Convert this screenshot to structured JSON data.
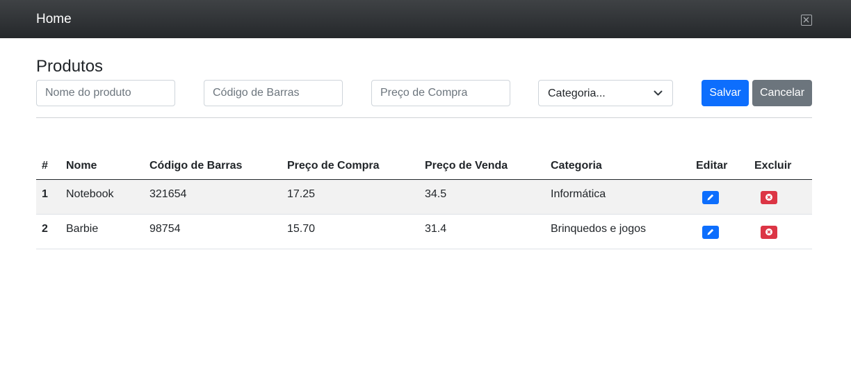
{
  "topbar": {
    "title": "Home",
    "close_icon": "close-icon"
  },
  "page": {
    "heading": "Produtos"
  },
  "form": {
    "name_placeholder": "Nome do produto",
    "barcode_placeholder": "Código de Barras",
    "price_placeholder": "Preço de Compra",
    "category_selected": "Categoria...",
    "save_label": "Salvar",
    "cancel_label": "Cancelar"
  },
  "table": {
    "headers": [
      "#",
      "Nome",
      "Código de Barras",
      "Preço de Compra",
      "Preço de Venda",
      "Categoria",
      "Editar",
      "Excluir"
    ],
    "rows": [
      {
        "id": "1",
        "name": "Notebook",
        "barcode": "321654",
        "purchase_price": "17.25",
        "sale_price": "34.5",
        "category": "Informática"
      },
      {
        "id": "2",
        "name": "Barbie",
        "barcode": "98754",
        "purchase_price": "15.70",
        "sale_price": "31.4",
        "category": "Brinquedos e jogos"
      }
    ]
  },
  "colors": {
    "primary": "#0d6efd",
    "secondary": "#6c757d",
    "danger": "#dc3545",
    "topbar": "#2b2e31"
  },
  "icons": {
    "edit": "pencil-icon",
    "delete": "x-circle-icon",
    "select": "chevron-down-icon"
  }
}
